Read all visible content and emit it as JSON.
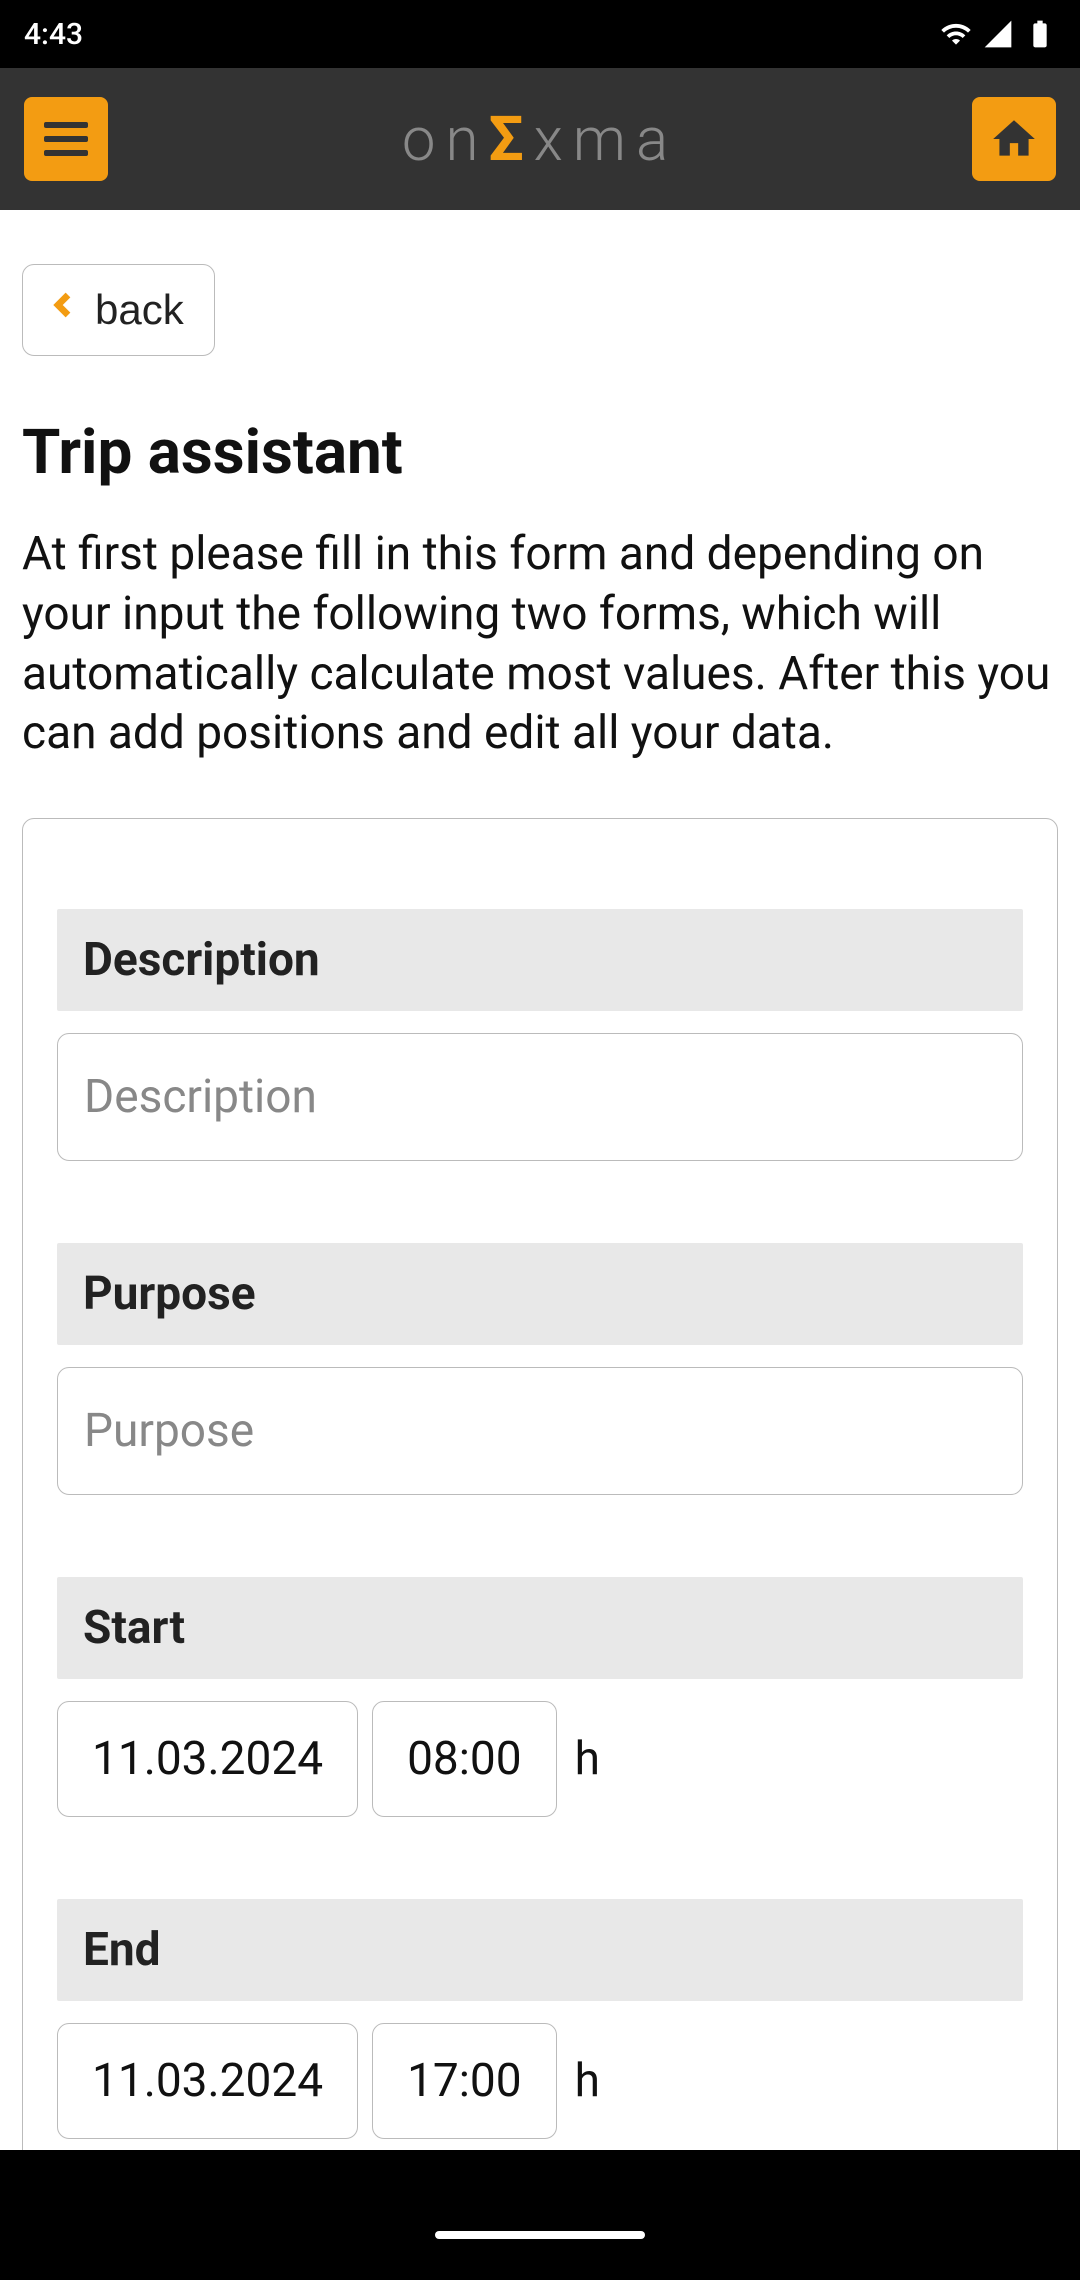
{
  "statusBar": {
    "time": "4:43"
  },
  "header": {
    "logoText1": "on",
    "logoSigma": "Σ",
    "logoText2": "xma"
  },
  "nav": {
    "backLabel": "back"
  },
  "page": {
    "title": "Trip assistant",
    "intro": "At first please fill in this form and depending on your input the following two forms, which will automatically calculate most values. After this you can add positions and edit all your data."
  },
  "form": {
    "description": {
      "label": "Description",
      "placeholder": "Description",
      "value": ""
    },
    "purpose": {
      "label": "Purpose",
      "placeholder": "Purpose",
      "value": ""
    },
    "start": {
      "label": "Start",
      "date": "11.03.2024",
      "time": "08:00",
      "unit": "h"
    },
    "end": {
      "label": "End",
      "date": "11.03.2024",
      "time": "17:00",
      "unit": "h"
    }
  }
}
